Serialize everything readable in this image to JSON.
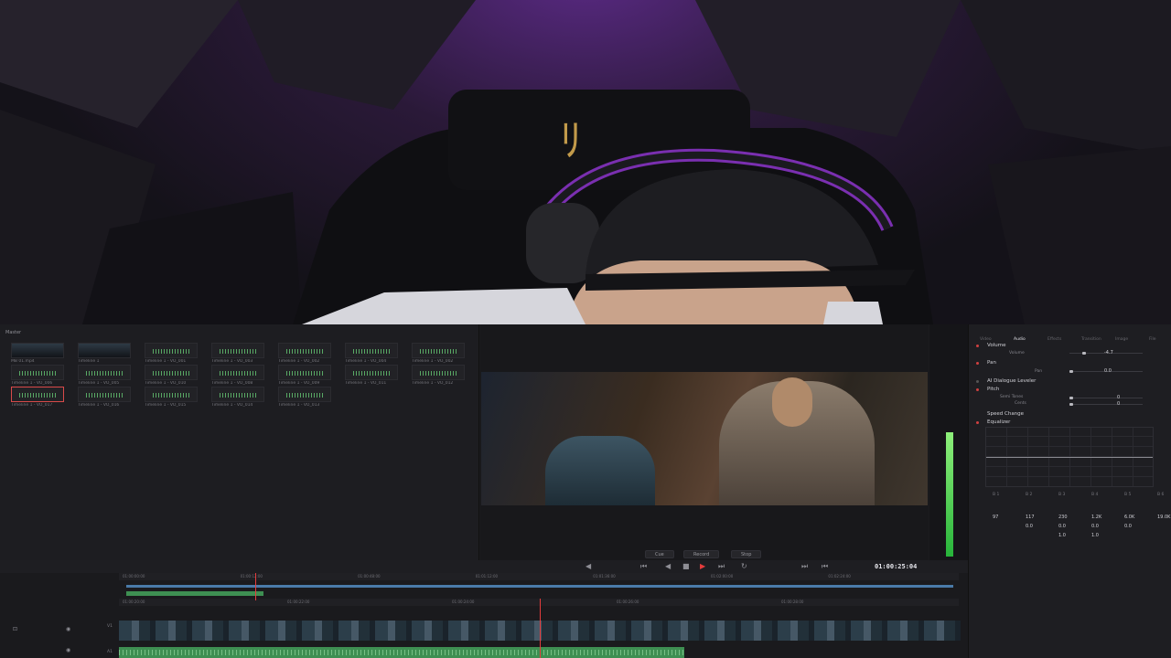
{
  "media_pool": {
    "title": "Master",
    "clips": [
      {
        "label": "MB 01.mp4",
        "kind": "video"
      },
      {
        "label": "Timeline 1",
        "kind": "timeline"
      },
      {
        "label": "Timeline 1 - VO_001",
        "kind": "audio"
      },
      {
        "label": "Timeline 1 - VO_003",
        "kind": "audio"
      },
      {
        "label": "Timeline 1 - VO_002",
        "kind": "audio"
      },
      {
        "label": "Timeline 1 - VO_004",
        "kind": "audio"
      },
      {
        "label": "Timeline 1 - VO_002",
        "kind": "audio"
      },
      {
        "label": "Timeline 1 - VO_006",
        "kind": "audio"
      },
      {
        "label": "Timeline 1 - VO_005",
        "kind": "audio"
      },
      {
        "label": "Timeline 1 - VO_010",
        "kind": "audio"
      },
      {
        "label": "Timeline 1 - VO_008",
        "kind": "audio"
      },
      {
        "label": "Timeline 1 - VO_009",
        "kind": "audio"
      },
      {
        "label": "Timeline 1 - VO_011",
        "kind": "audio"
      },
      {
        "label": "Timeline 1 - VO_012",
        "kind": "audio"
      },
      {
        "label": "Timeline 1 - VO_017",
        "kind": "audio",
        "selected": true
      },
      {
        "label": "Timeline 1 - VO_016",
        "kind": "audio"
      },
      {
        "label": "Timeline 1 - VO_015",
        "kind": "audio"
      },
      {
        "label": "Timeline 1 - VO_014",
        "kind": "audio"
      },
      {
        "label": "Timeline 1 - VO_013",
        "kind": "audio"
      }
    ]
  },
  "viewer": {
    "buttons": {
      "cue": "Cue",
      "record": "Record",
      "stop": "Stop"
    },
    "meter_level": 0.55
  },
  "inspector": {
    "tabs": [
      "Video",
      "Audio",
      "Effects",
      "Transition",
      "Image",
      "File"
    ],
    "active_tab": "Audio",
    "volume": {
      "title": "Volume",
      "label": "Volume",
      "value": "-4.7"
    },
    "pan": {
      "title": "Pan",
      "label": "Pan",
      "value": "0.0"
    },
    "dialogue": {
      "title": "AI Dialogue Leveler"
    },
    "pitch": {
      "title": "Pitch",
      "semi_label": "Semi Tones",
      "semi_value": "0",
      "cents_label": "Cents",
      "cents_value": "0"
    },
    "speed": {
      "title": "Speed Change"
    },
    "equalizer": {
      "title": "Equalizer",
      "bands": [
        "B 1",
        "B 2",
        "B 3",
        "B 4",
        "B 5",
        "B 6"
      ],
      "freq": [
        "97",
        "117",
        "230",
        "1.2K",
        "6.0K",
        "19.0K"
      ],
      "gain": [
        "",
        "0.0",
        "0.0",
        "0.0",
        "0.0",
        ""
      ],
      "q": [
        "",
        "",
        "1.0",
        "1.0",
        "",
        ""
      ]
    }
  },
  "timeline": {
    "timecode": "01:00:25:04",
    "upper_ruler": [
      "01:00:00:00",
      "01:00:12:00",
      "01:00:48:00",
      "01:01:12:00",
      "01:01:36:00",
      "01:02:00:00",
      "01:02:24:00"
    ],
    "lower_ruler": [
      "01:00:20:00",
      "01:00:22:00",
      "01:00:24:00",
      "01:00:26:00",
      "01:00:28:00"
    ],
    "tracks": [
      "V1",
      "A1"
    ]
  },
  "colors": {
    "accent_red": "#e53c3c",
    "audio_green": "#3e8f52",
    "meter_green": "#27b43a"
  }
}
